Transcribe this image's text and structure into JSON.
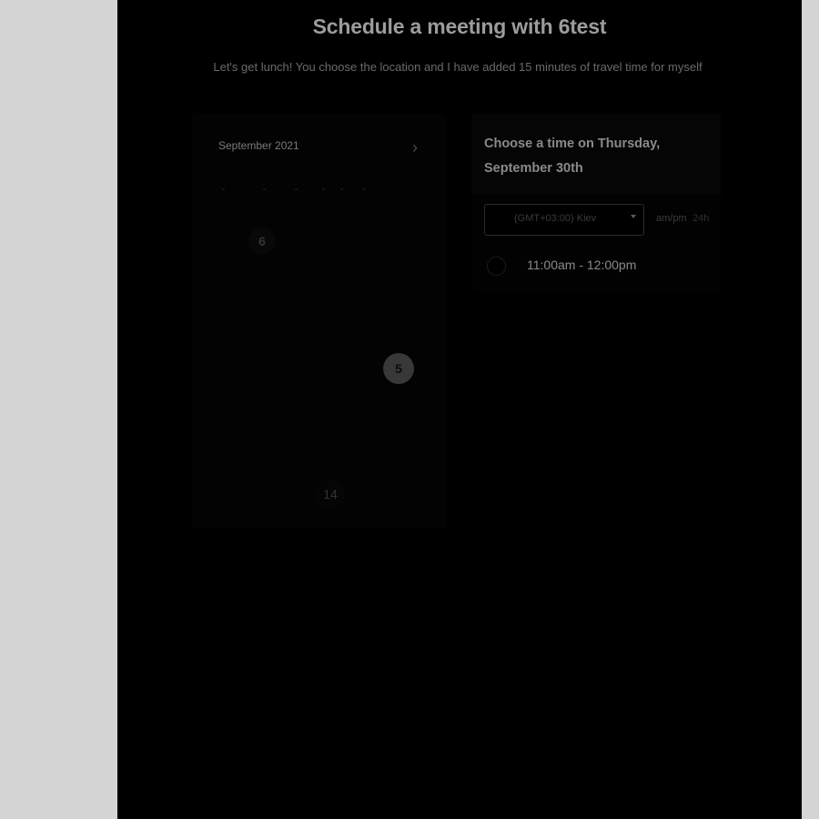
{
  "page": {
    "title": "Schedule a meeting with 6test",
    "subtitle": "Let's get lunch! You choose the location and I have added 15 minutes of travel time for myself"
  },
  "calendar": {
    "month_label": "September 2021",
    "next_icon": "chevron-right-icon",
    "visible_days": [
      "6",
      "5",
      "14"
    ]
  },
  "times": {
    "heading": "Choose a time on Thursday, September 30th",
    "timezone_value": "(GMT+03:00) Kiev",
    "format_ampm": "am/pm",
    "format_24h": "24h",
    "slots": [
      {
        "label": "11:00am - 12:00pm"
      }
    ]
  },
  "colors": {
    "backdrop": "#d4d4d4",
    "panel": "#000000",
    "title_text": "#9c9c9c"
  }
}
